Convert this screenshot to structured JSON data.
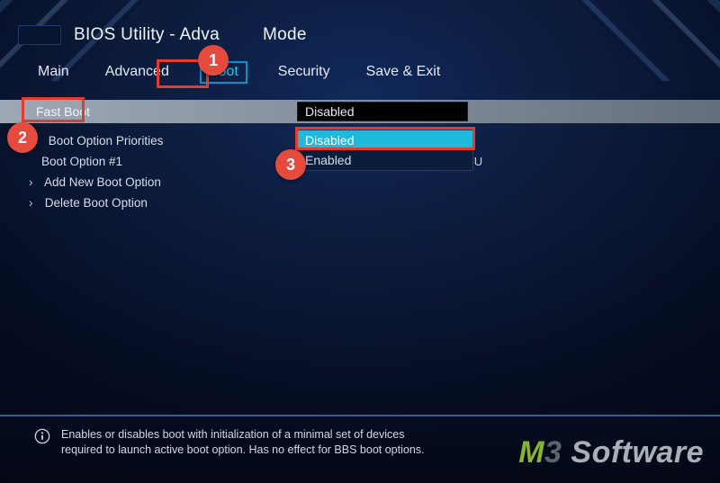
{
  "header": {
    "title_full": "BIOS Utility - Advanced Mode",
    "title_left": "BIOS Utility - Adva",
    "title_right": "Mode"
  },
  "tabs": [
    "Main",
    "Advanced",
    "Boot",
    "Security",
    "Save & Exit"
  ],
  "active_tab_index": 2,
  "boot": {
    "selected_setting": {
      "label": "Fast Boot",
      "value": "Disabled"
    },
    "dropdown": {
      "options": [
        "Disabled",
        "Enabled"
      ],
      "selected_index": 0
    },
    "items": [
      {
        "label": "Boot Option Priorities",
        "type": "link"
      },
      {
        "label": "Boot Option #1",
        "value": "Windows Boot Manager (SAMSU",
        "type": "kv"
      },
      {
        "label": "Add New Boot Option",
        "type": "link"
      },
      {
        "label": "Delete Boot Option",
        "type": "link"
      }
    ]
  },
  "footer": {
    "help_text": "Enables or disables boot with initialization of a minimal set of devices required to launch active boot option. Has no effect for BBS boot options."
  },
  "annotations": {
    "badges": [
      "1",
      "2",
      "3"
    ]
  },
  "watermark": {
    "m": "M",
    "three": "3",
    "rest": " Software"
  }
}
